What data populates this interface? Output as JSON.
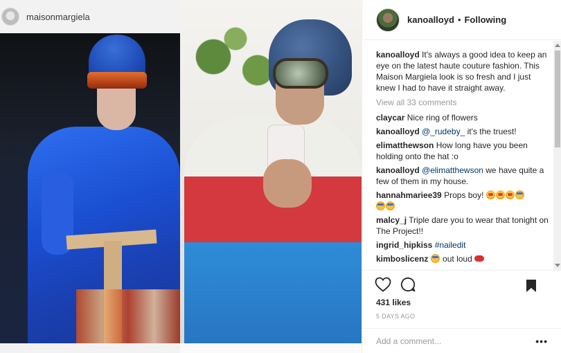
{
  "media": {
    "inner_username": "maisonmargiela"
  },
  "post": {
    "username": "kanoalloyd",
    "separator": "•",
    "follow_status": "Following",
    "caption_user": "kanoalloyd",
    "caption_text": "It's always a good idea to keep an eye on the latest haute couture fashion. This Maison Margiela look is so fresh and I just knew I had to have it straight away.",
    "view_all": "View all 33 comments",
    "comments": [
      {
        "user": "claycar",
        "text": "Nice ring of flowers"
      },
      {
        "user": "kanoalloyd",
        "mention": "@_rudeby_",
        "text": "it's the truest!"
      },
      {
        "user": "elimatthewson",
        "text": "How long have you been holding onto the hat :o"
      },
      {
        "user": "kanoalloyd",
        "mention": "@elimatthewson",
        "text": "we have quite a few of them in my house."
      },
      {
        "user": "hannahmariee39",
        "text": "Props boy!"
      },
      {
        "user": "malcy_j",
        "text": "Triple dare you to wear that tonight on The Project!!"
      },
      {
        "user": "ingrid_hipkiss",
        "mention": "#nailedit",
        "text": ""
      },
      {
        "user": "kimboslicenz",
        "text": "out loud"
      }
    ],
    "likes": "431 likes",
    "time_ago": "5 DAYS AGO",
    "comment_placeholder": "Add a comment...",
    "more_label": "•••"
  },
  "icons": {
    "like": "heart-icon",
    "comment": "comment-bubble-icon",
    "save": "bookmark-icon"
  }
}
